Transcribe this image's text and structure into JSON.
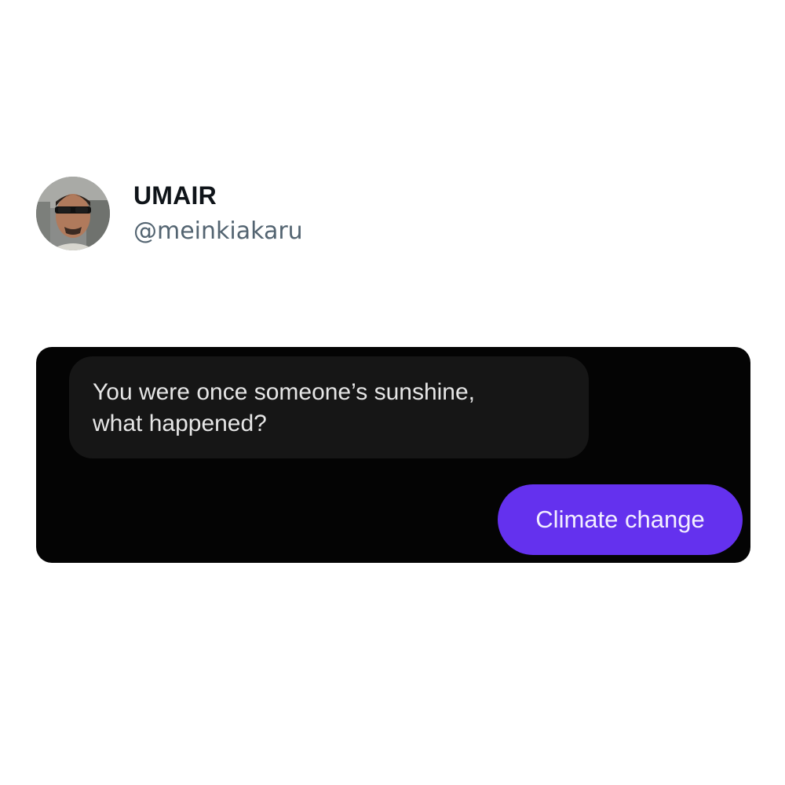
{
  "post": {
    "author": {
      "display_name": "UMAIR",
      "handle": "@meinkiakaru"
    }
  },
  "chat": {
    "received_message": {
      "lines": [
        "You were once someone’s sunshine,",
        "what happened?"
      ]
    },
    "sent_message": {
      "text": "Climate change"
    }
  },
  "colors": {
    "chat_background": "#040404",
    "received_bubble": "#161616",
    "sent_bubble": "#6431ee",
    "handle_text": "#536471"
  }
}
